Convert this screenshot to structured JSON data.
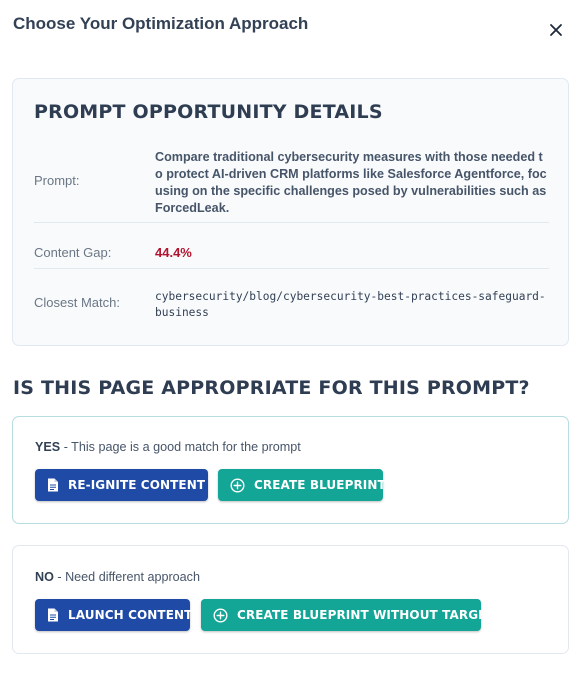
{
  "modal": {
    "title": "Choose Your Optimization Approach",
    "close_icon": "close-icon"
  },
  "details": {
    "heading": "Prompt Opportunity Details",
    "prompt_label": "Prompt:",
    "prompt_value": "Compare traditional cybersecurity measures with those needed to protect AI-driven CRM platforms like Salesforce Agentforce, focusing on the specific challenges posed by vulnerabilities such as ForcedLeak.",
    "gap_label": "Content Gap:",
    "gap_value": "44.4%",
    "match_label": "Closest Match:",
    "match_value": "cybersecurity/blog/cybersecurity-best-practices-safeguard-business"
  },
  "question": {
    "heading": "Is this page appropriate for this prompt?"
  },
  "option_yes": {
    "keyword": "YES",
    "description": " - This page is a good match for the prompt",
    "primary_button": {
      "label": "Re-ignite Content",
      "icon": "document-icon"
    },
    "secondary_button": {
      "label": "Create Blueprint",
      "icon": "plus-circle-icon"
    }
  },
  "option_no": {
    "keyword": "NO",
    "description": " - Need different approach",
    "primary_button": {
      "label": "Launch Content",
      "icon": "document-icon"
    },
    "secondary_button": {
      "label": "Create Blueprint Without Target",
      "icon": "plus-circle-icon"
    }
  },
  "colors": {
    "primary_blue": "#1f4ba6",
    "teal": "#13a596",
    "gap_red": "#b3132e",
    "yes_border": "#b6dde0"
  }
}
